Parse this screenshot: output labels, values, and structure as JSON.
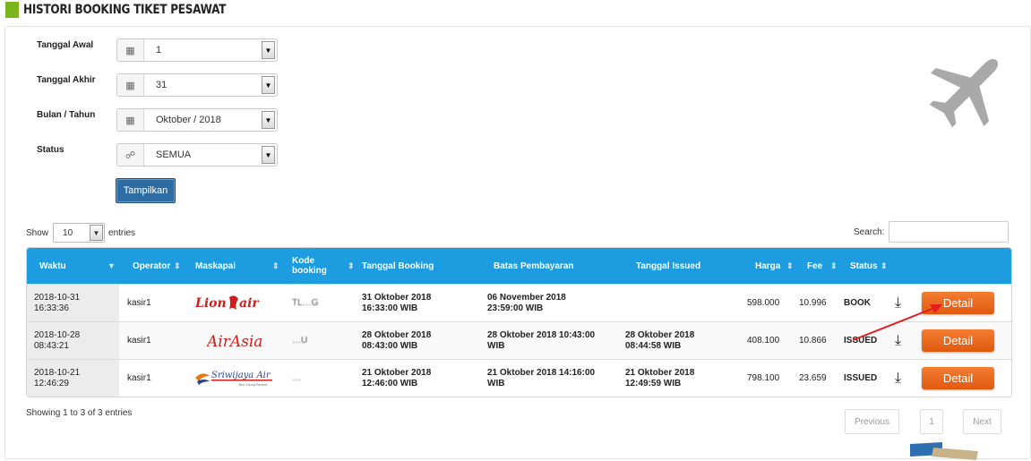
{
  "header": {
    "title": "HISTORI BOOKING TIKET PESAWAT"
  },
  "form": {
    "start_label": "Tanggal Awal",
    "start_value": "1",
    "end_label": "Tanggal Akhir",
    "end_value": "31",
    "month_label": "Bulan / Tahun",
    "month_value": "Oktober / 2018",
    "status_label": "Status",
    "status_value": "SEMUA",
    "submit_label": "Tampilkan"
  },
  "table_controls": {
    "show_label": "Show",
    "entries_value": "10",
    "entries_label": "entries",
    "search_label": "Search:"
  },
  "table": {
    "columns": [
      "Waktu",
      "Operator",
      "Maskapai",
      "Kode booking",
      "Tanggal Booking",
      "Batas Pembayaran",
      "Tanggal Issued",
      "Harga",
      "Fee",
      "Status"
    ],
    "rows": [
      {
        "waktu_date": "2018-10-31",
        "waktu_time": "16:33:36",
        "operator": "kasir1",
        "airline": "Lion air",
        "code": "TL…G",
        "booking_date": "31 Oktober 2018",
        "booking_time": "16:33:00 WIB",
        "payment_date": "06 November 2018",
        "payment_time": "23:59:00 WIB",
        "issued_date": "",
        "issued_time": "",
        "price": "598.000",
        "fee": "10.996",
        "status": "BOOK",
        "action": "Detail"
      },
      {
        "waktu_date": "2018-10-28",
        "waktu_time": "08:43:21",
        "operator": "kasir1",
        "airline": "AirAsia",
        "code": "…U",
        "booking_date": "28 Oktober 2018",
        "booking_time": "08:43:00 WIB",
        "payment_date": "28 Oktober 2018 10:43:00",
        "payment_time": "WIB",
        "issued_date": "28 Oktober 2018",
        "issued_time": "08:44:58 WIB",
        "price": "408.100",
        "fee": "10.866",
        "status": "ISSUED",
        "action": "Detail"
      },
      {
        "waktu_date": "2018-10-21",
        "waktu_time": "12:46:29",
        "operator": "kasir1",
        "airline": "Sriwijaya Air",
        "code": "…",
        "booking_date": "21 Oktober 2018",
        "booking_time": "12:46:00 WIB",
        "payment_date": "21 Oktober 2018 14:16:00",
        "payment_time": "WIB",
        "issued_date": "21 Oktober 2018",
        "issued_time": "12:49:59 WIB",
        "price": "798.100",
        "fee": "23.659",
        "status": "ISSUED",
        "action": "Detail"
      }
    ]
  },
  "footer": {
    "info": "Showing 1 to 3 of 3 entries",
    "prev": "Previous",
    "page": "1",
    "next": "Next"
  },
  "icons": {
    "calendar": "calendar-icon",
    "key": "key-icon",
    "plane": "airplane-icon",
    "download": "download-icon"
  },
  "colors": {
    "accent": "#1d9ce0",
    "button": "#2e6da4",
    "detail": "#e8621a",
    "header_bar": "#7ab51d"
  }
}
